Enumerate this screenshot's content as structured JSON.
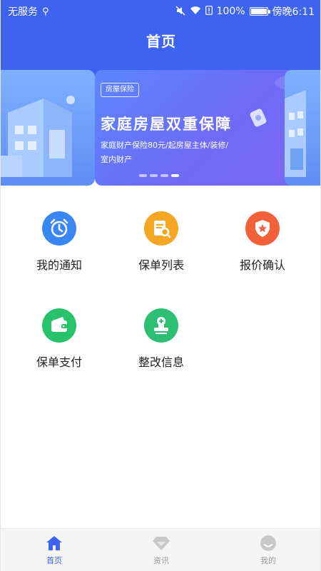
{
  "status_bar": {
    "carrier": "无服务",
    "battery_text": "100%",
    "time": "傍晚6:11"
  },
  "header": {
    "title": "首页"
  },
  "banner": {
    "tag": "房屋保险",
    "headline": "家庭房屋双重保障",
    "description": "家庭财产保险80元/起房屋主体/装修/室内财产",
    "slide_count": 4,
    "active_index": 4
  },
  "features": [
    {
      "label": "我的通知",
      "icon": "alarm-clock-icon",
      "color": "#3A86F4"
    },
    {
      "label": "保单列表",
      "icon": "document-search-icon",
      "color": "#F5A623"
    },
    {
      "label": "报价确认",
      "icon": "shield-star-icon",
      "color": "#F2603A"
    },
    {
      "label": "保单支付",
      "icon": "wallet-icon",
      "color": "#27C26B"
    },
    {
      "label": "整改信息",
      "icon": "stamp-icon",
      "color": "#2DBD73"
    }
  ],
  "bottom_nav": [
    {
      "label": "首页",
      "icon": "home-icon",
      "active": true
    },
    {
      "label": "资讯",
      "icon": "diamond-icon",
      "active": false
    },
    {
      "label": "我的",
      "icon": "profile-icon",
      "active": false
    }
  ],
  "colors": {
    "primary": "#3D63F0",
    "inactive": "#999999"
  }
}
